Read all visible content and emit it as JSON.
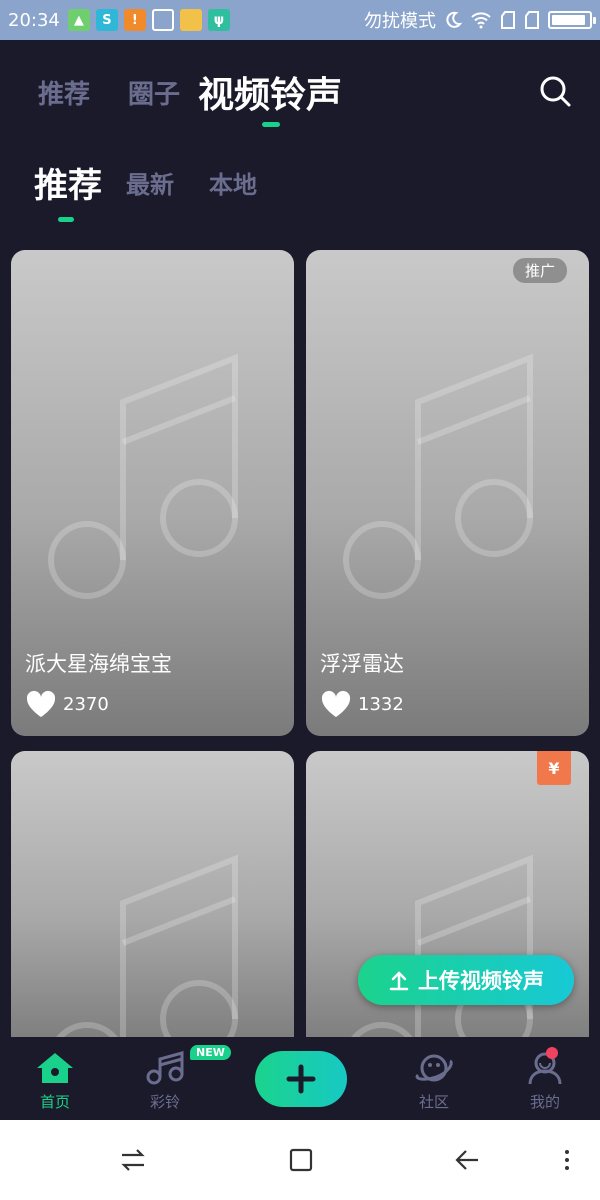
{
  "status_bar": {
    "time": "20:34",
    "dnd_label": "勿扰模式",
    "battery_level": 0.92,
    "app_icons": [
      {
        "name": "android-robot-icon",
        "color": "#6fcf6f",
        "glyph": "▲"
      },
      {
        "name": "s-app-icon",
        "color": "#2fb7d8",
        "glyph": "S"
      },
      {
        "name": "warning-icon",
        "color": "#f08a2a",
        "glyph": "!"
      },
      {
        "name": "broom-icon",
        "color": "#8aa4cc",
        "glyph": "⌂"
      },
      {
        "name": "folder-icon",
        "color": "#f2c14a",
        "glyph": ""
      },
      {
        "name": "usb-icon",
        "color": "#2fbf9f",
        "glyph": "ψ"
      }
    ]
  },
  "top_tabs": {
    "items": [
      "推荐",
      "圈子",
      "视频铃声"
    ],
    "active_index": 2
  },
  "sub_tabs": {
    "items": [
      "推荐",
      "最新",
      "本地"
    ],
    "active_index": 0
  },
  "cards": [
    {
      "title": "派大星海绵宝宝",
      "likes": "2370",
      "badge": ""
    },
    {
      "title": "浮浮雷达",
      "likes": "1332",
      "badge": "推广"
    },
    {
      "title": "",
      "likes": "",
      "badge": ""
    },
    {
      "title": "",
      "likes": "",
      "badge": "¥"
    }
  ],
  "upload_button": {
    "label": "上传视频铃声"
  },
  "bottom_nav": {
    "items": [
      {
        "label": "首页",
        "icon": "home-icon",
        "active": true
      },
      {
        "label": "彩铃",
        "icon": "music-note-icon",
        "active": false,
        "badge": "NEW"
      },
      {
        "label": "",
        "icon": "plus-icon",
        "active": false
      },
      {
        "label": "社区",
        "icon": "planet-icon",
        "active": false
      },
      {
        "label": "我的",
        "icon": "profile-icon",
        "active": false
      }
    ]
  },
  "colors": {
    "background": "#1b1a2b",
    "accent": "#19d18a",
    "inactive_tab": "#6a6d8e",
    "status_bar": "#8aa4cc"
  }
}
